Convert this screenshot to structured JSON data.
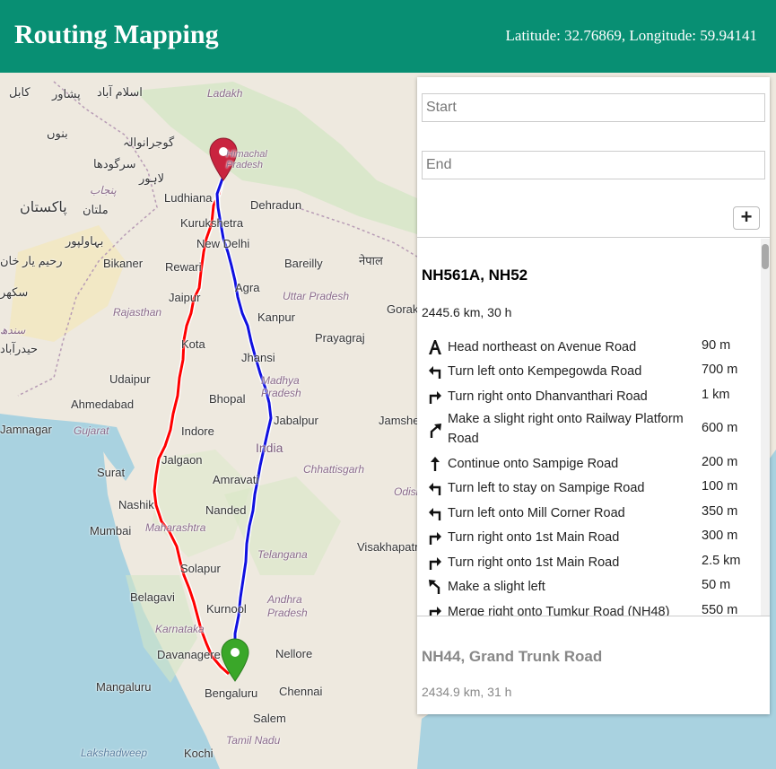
{
  "header": {
    "title": "Routing Mapping",
    "coordinates": "Latitude: 32.76869, Longitude: 59.94141"
  },
  "colors": {
    "header_bg": "#088f73",
    "route_primary": "#ff0000",
    "route_alternative": "#1010e0",
    "start_marker": "#c9243f",
    "end_marker": "#3aa729"
  },
  "map": {
    "labels": [
      {
        "text": "کابل",
        "kind": "city"
      },
      {
        "text": "پشاور",
        "kind": "city"
      },
      {
        "text": "اسلام آباد",
        "kind": "city"
      },
      {
        "text": "Ladakh",
        "kind": "state"
      },
      {
        "text": "بنوں",
        "kind": "city"
      },
      {
        "text": "گوجرانوالہ",
        "kind": "city"
      },
      {
        "text": "سرگودھا",
        "kind": "city"
      },
      {
        "text": "لاہور",
        "kind": "city"
      },
      {
        "text": "پنجاب",
        "kind": "state"
      },
      {
        "text": "Himachal Pradesh",
        "kind": "state"
      },
      {
        "text": "Ludhiana",
        "kind": "city"
      },
      {
        "text": "Dehradun",
        "kind": "city"
      },
      {
        "text": "پاکستان",
        "kind": "country"
      },
      {
        "text": "ملتان",
        "kind": "city"
      },
      {
        "text": "Kurukshetra",
        "kind": "city"
      },
      {
        "text": "New Delhi",
        "kind": "city"
      },
      {
        "text": "بہاولپور",
        "kind": "city"
      },
      {
        "text": "رحیم یار خان",
        "kind": "city"
      },
      {
        "text": "Bikaner",
        "kind": "city"
      },
      {
        "text": "Rewari",
        "kind": "city"
      },
      {
        "text": "Bareilly",
        "kind": "city"
      },
      {
        "text": "नेपाल",
        "kind": "country"
      },
      {
        "text": "سکھر",
        "kind": "city"
      },
      {
        "text": "Agra",
        "kind": "city"
      },
      {
        "text": "Uttar Pradesh",
        "kind": "state"
      },
      {
        "text": "Jaipur",
        "kind": "city"
      },
      {
        "text": "Gorakhpur",
        "kind": "city"
      },
      {
        "text": "Rajasthan",
        "kind": "state"
      },
      {
        "text": "Kanpur",
        "kind": "city"
      },
      {
        "text": "سندھ",
        "kind": "state"
      },
      {
        "text": "حیدرآباد",
        "kind": "city"
      },
      {
        "text": "Kota",
        "kind": "city"
      },
      {
        "text": "Prayagraj",
        "kind": "city"
      },
      {
        "text": "Jhansi",
        "kind": "city"
      },
      {
        "text": "Udaipur",
        "kind": "city"
      },
      {
        "text": "Madhya Pradesh",
        "kind": "state"
      },
      {
        "text": "Bhopal",
        "kind": "city"
      },
      {
        "text": "Ahmedabad",
        "kind": "city"
      },
      {
        "text": "Jabalpur",
        "kind": "city"
      },
      {
        "text": "Jamshedpur",
        "kind": "city"
      },
      {
        "text": "Jamnagar",
        "kind": "city"
      },
      {
        "text": "Gujarat",
        "kind": "state"
      },
      {
        "text": "Indore",
        "kind": "city"
      },
      {
        "text": "India",
        "kind": "country"
      },
      {
        "text": "Jalgaon",
        "kind": "city"
      },
      {
        "text": "Chhattisgarh",
        "kind": "state"
      },
      {
        "text": "Surat",
        "kind": "city"
      },
      {
        "text": "Amravati",
        "kind": "city"
      },
      {
        "text": "Odisha",
        "kind": "state"
      },
      {
        "text": "Nashik",
        "kind": "city"
      },
      {
        "text": "Nanded",
        "kind": "city"
      },
      {
        "text": "Mumbai",
        "kind": "city"
      },
      {
        "text": "Maharashtra",
        "kind": "state"
      },
      {
        "text": "Telangana",
        "kind": "state"
      },
      {
        "text": "Visakhapatnam",
        "kind": "city"
      },
      {
        "text": "Solapur",
        "kind": "city"
      },
      {
        "text": "Belagavi",
        "kind": "city"
      },
      {
        "text": "Kurnool",
        "kind": "city"
      },
      {
        "text": "Andhra Pradesh",
        "kind": "state"
      },
      {
        "text": "Karnataka",
        "kind": "state"
      },
      {
        "text": "Davanagere",
        "kind": "city"
      },
      {
        "text": "Nellore",
        "kind": "city"
      },
      {
        "text": "Mangaluru",
        "kind": "city"
      },
      {
        "text": "Bengaluru",
        "kind": "city"
      },
      {
        "text": "Chennai",
        "kind": "city"
      },
      {
        "text": "Salem",
        "kind": "city"
      },
      {
        "text": "Tamil Nadu",
        "kind": "state"
      },
      {
        "text": "Lakshadweep",
        "kind": "sea"
      },
      {
        "text": "Kochi",
        "kind": "city"
      }
    ]
  },
  "panel": {
    "start_placeholder": "Start",
    "end_placeholder": "End",
    "add_label": "+",
    "selected_route": {
      "name": "NH561A, NH52",
      "summary": "2445.6 km, 30 h",
      "instructions": [
        {
          "icon": "depart-icon",
          "text": "Head northeast on Avenue Road",
          "distance": "90 m"
        },
        {
          "icon": "turn-left-icon",
          "text": "Turn left onto Kempegowda Road",
          "distance": "700 m"
        },
        {
          "icon": "turn-right-icon",
          "text": "Turn right onto Dhanvanthari Road",
          "distance": "1 km"
        },
        {
          "icon": "slight-right-icon",
          "text": "Make a slight right onto Railway Platform Road",
          "distance": "600 m"
        },
        {
          "icon": "continue-icon",
          "text": "Continue onto Sampige Road",
          "distance": "200 m"
        },
        {
          "icon": "turn-left-icon",
          "text": "Turn left to stay on Sampige Road",
          "distance": "100 m"
        },
        {
          "icon": "turn-left-icon",
          "text": "Turn left onto Mill Corner Road",
          "distance": "350 m"
        },
        {
          "icon": "turn-right-icon",
          "text": "Turn right onto 1st Main Road",
          "distance": "300 m"
        },
        {
          "icon": "turn-right-icon",
          "text": "Turn right onto 1st Main Road",
          "distance": "2.5 km"
        },
        {
          "icon": "slight-left-icon",
          "text": "Make a slight left",
          "distance": "50 m"
        },
        {
          "icon": "turn-right-icon",
          "text": "Merge right onto Tumkur Road (NH48)",
          "distance": "550 m"
        }
      ]
    },
    "alternative_route": {
      "name": "NH44, Grand Trunk Road",
      "summary": "2434.9 km, 31 h"
    }
  }
}
